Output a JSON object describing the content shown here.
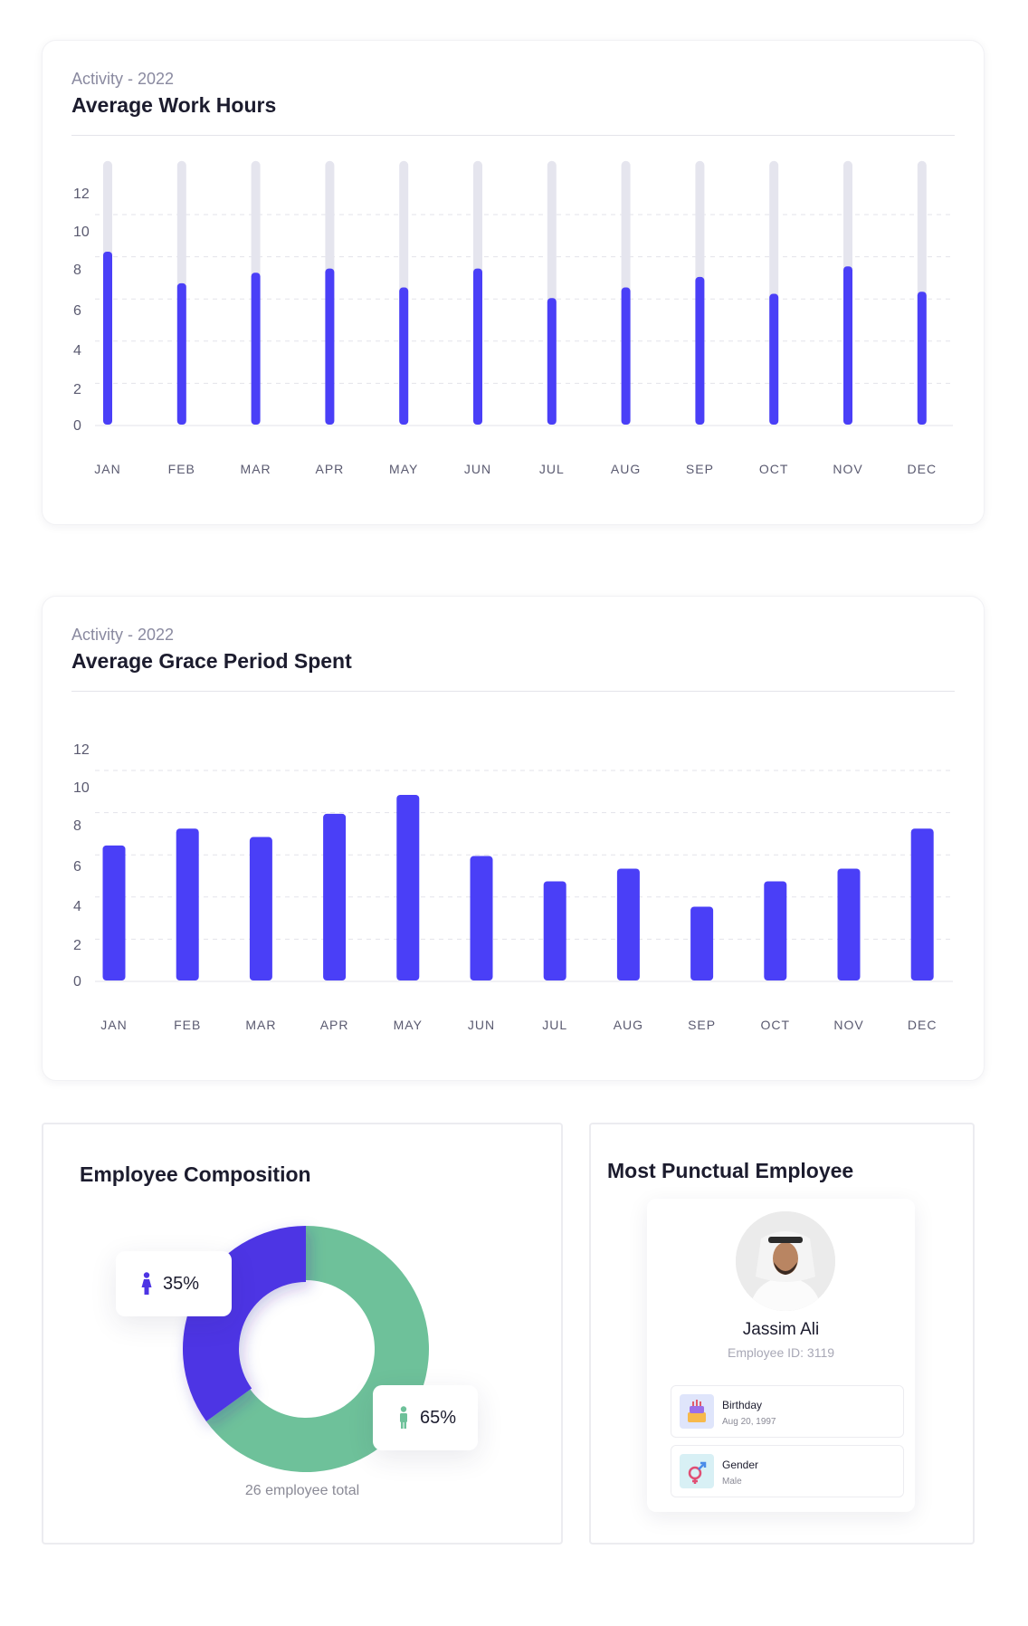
{
  "charts": [
    {
      "subtitle": "Activity - 2022",
      "title": "Average Work Hours"
    },
    {
      "subtitle": "Activity - 2022",
      "title": "Average Grace Period Spent"
    }
  ],
  "chart_data": [
    {
      "type": "bar",
      "subtitle": "Activity - 2022",
      "title": "Average Work Hours",
      "categories": [
        "JAN",
        "FEB",
        "MAR",
        "APR",
        "MAY",
        "JUN",
        "JUL",
        "AUG",
        "SEP",
        "OCT",
        "NOV",
        "DEC"
      ],
      "y_ticks": [
        0,
        2,
        4,
        6,
        8,
        10,
        12
      ],
      "ylim": [
        0,
        12.5
      ],
      "background_bar_max": 12.5,
      "values": [
        8.2,
        6.7,
        7.2,
        7.4,
        6.5,
        7.4,
        6.0,
        6.5,
        7.0,
        6.2,
        7.5,
        6.3
      ],
      "grid": "dashed",
      "colors": {
        "bar": "#4a3ff7",
        "track": "#e5e5ee"
      }
    },
    {
      "type": "bar",
      "subtitle": "Activity - 2022",
      "title": "Average Grace Period Spent",
      "categories": [
        "JAN",
        "FEB",
        "MAR",
        "APR",
        "MAY",
        "JUN",
        "JUL",
        "AUG",
        "SEP",
        "OCT",
        "NOV",
        "DEC"
      ],
      "y_ticks": [
        0,
        2,
        4,
        6,
        8,
        10,
        12
      ],
      "ylim": [
        0,
        12.5
      ],
      "values": [
        6.4,
        7.2,
        6.8,
        7.9,
        8.8,
        5.9,
        4.7,
        5.3,
        3.5,
        4.7,
        5.3,
        7.2
      ],
      "grid": "dashed",
      "colors": {
        "bar": "#4a3ff7"
      }
    },
    {
      "type": "pie",
      "title": "Employee Composition",
      "slices": [
        {
          "label": "female",
          "value": 35,
          "display": "35%",
          "color": "#4d34e4"
        },
        {
          "label": "male",
          "value": 65,
          "display": "65%",
          "color": "#6ec19a"
        }
      ],
      "total_text": "26 employee total"
    }
  ],
  "composition": {
    "title": "Employee Composition",
    "female_pct": "35%",
    "male_pct": "65%",
    "total_text": "26 employee total"
  },
  "punctual": {
    "title": "Most Punctual Employee",
    "name": "Jassim Ali",
    "employee_id": "Employee ID: 3119",
    "rows": [
      {
        "label": "Birthday",
        "value": "Aug 20, 1997",
        "icon": "cake-icon"
      },
      {
        "label": "Gender",
        "value": "Male",
        "icon": "gender-icon"
      }
    ]
  }
}
